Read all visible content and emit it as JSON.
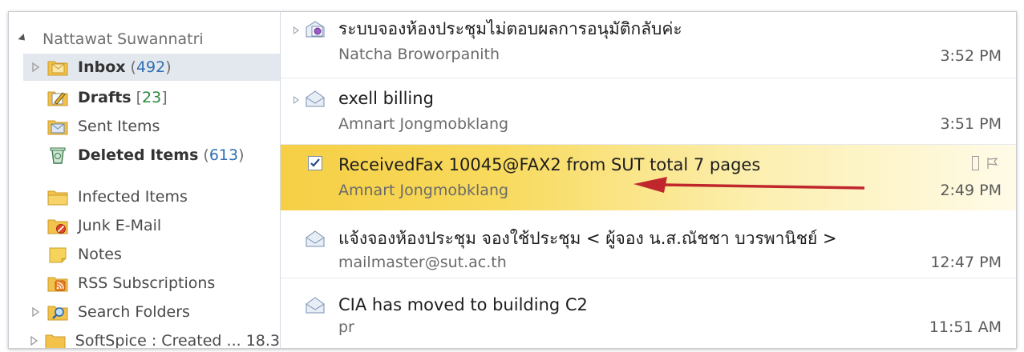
{
  "folders": {
    "account_name": "Nattawat Suwannatri",
    "items": [
      {
        "name": "Inbox",
        "count": "492",
        "paren_open": "(",
        "paren_close": ")"
      },
      {
        "name": "Drafts",
        "count": "23",
        "paren_open": "[",
        "paren_close": "]"
      },
      {
        "name": "Sent Items"
      },
      {
        "name": "Deleted Items",
        "count": "613",
        "paren_open": "(",
        "paren_close": ")"
      },
      {
        "name": "Infected Items"
      },
      {
        "name": "Junk E-Mail"
      },
      {
        "name": "Notes"
      },
      {
        "name": "RSS Subscriptions"
      },
      {
        "name": "Search Folders"
      },
      {
        "name": "SoftSpice : Created ... 18.3"
      }
    ]
  },
  "messages": [
    {
      "subject": "ระบบจองห้องประชุมไม่ตอบผลการอนุมัติกลับค่ะ",
      "sender": "Natcha Broworpanith",
      "time": "3:52 PM"
    },
    {
      "subject": "exell billing",
      "sender": "Amnart Jongmobklang",
      "time": "3:51 PM"
    },
    {
      "subject": "ReceivedFax 10045@FAX2 from SUT total 7 pages",
      "sender": "Amnart Jongmobklang",
      "time": "2:49 PM"
    },
    {
      "subject": "แจ้งจองห้องประชุม จองใช้ประชุม < ผู้จอง น.ส.ณัชชา บวรพานิชย์ >",
      "sender": "mailmaster@sut.ac.th",
      "time": "12:47 PM"
    },
    {
      "subject": "CIA has moved to building C2",
      "sender": "pr",
      "time": "11:51 AM"
    }
  ],
  "colors": {
    "selected_folder_bg": "#e3e8ee",
    "selected_message_bg": "#f6cf45",
    "annotation_arrow": "#c0272d",
    "count_blue": "#2e6db4",
    "count_green": "#2a8a3c"
  }
}
